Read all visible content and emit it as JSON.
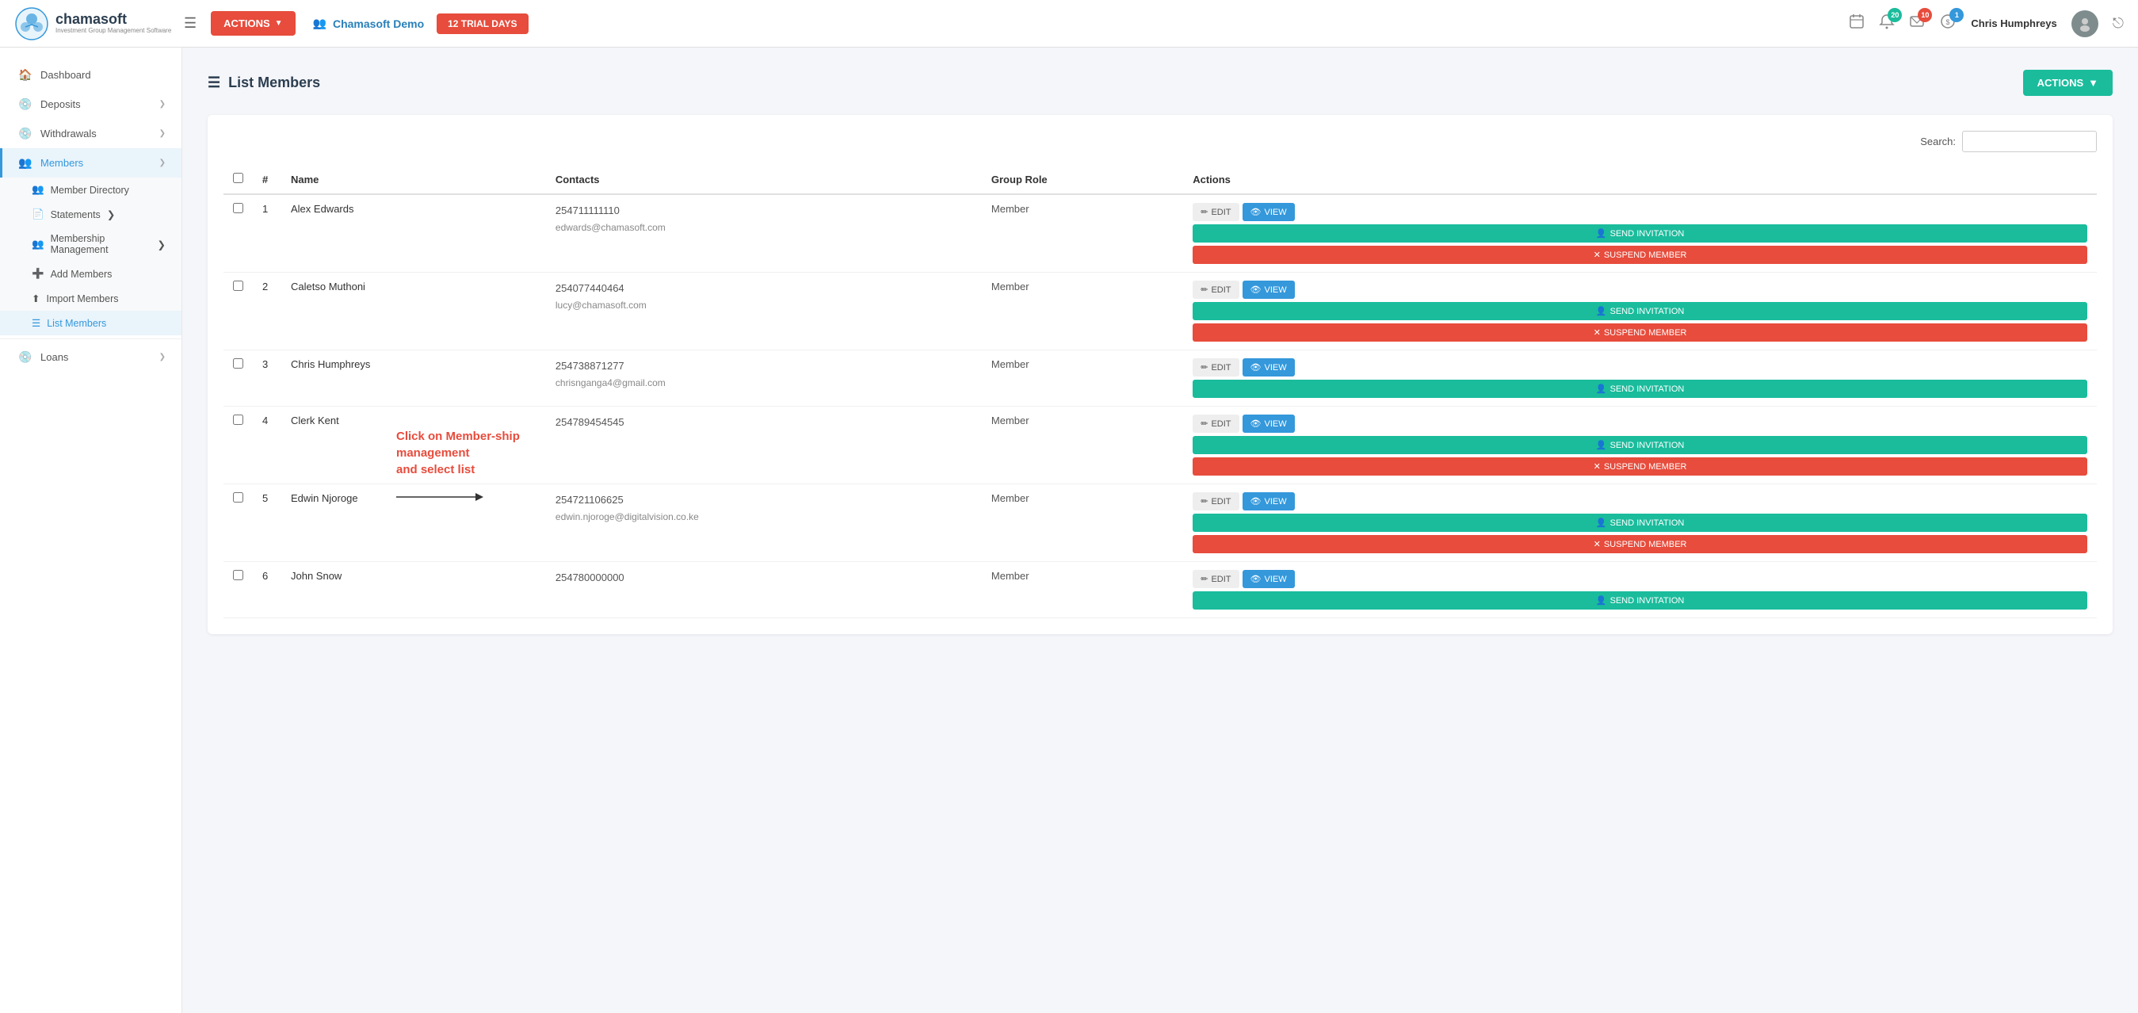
{
  "header": {
    "logo_name": "chamasoft",
    "logo_subtitle": "Investment Group Management Software",
    "hamburger_icon": "☰",
    "actions_label": "ACTIONS",
    "group_icon": "👥",
    "group_name": "Chamasoft Demo",
    "trial_label": "12 TRIAL DAYS",
    "notifications_count": "20",
    "messages_count": "10",
    "payments_count": "1",
    "user_name": "Chris Humphreys",
    "logout_icon": "⎋"
  },
  "sidebar": {
    "items": [
      {
        "id": "dashboard",
        "icon": "🏠",
        "label": "Dashboard",
        "active": false
      },
      {
        "id": "deposits",
        "icon": "💿",
        "label": "Deposits",
        "has_arrow": true,
        "active": false
      },
      {
        "id": "withdrawals",
        "icon": "💿",
        "label": "Withdrawals",
        "has_arrow": true,
        "active": false
      },
      {
        "id": "members",
        "icon": "👥",
        "label": "Members",
        "has_arrow": true,
        "active": true
      }
    ],
    "members_sub": [
      {
        "id": "member-directory",
        "icon": "👥",
        "label": "Member Directory",
        "active": false
      },
      {
        "id": "statements",
        "icon": "📄",
        "label": "Statements",
        "has_arrow": true,
        "active": false
      },
      {
        "id": "membership-management",
        "icon": "👥",
        "label": "Membership Management",
        "has_arrow": true,
        "active": false
      },
      {
        "id": "add-members",
        "icon": "➕",
        "label": "Add Members",
        "active": false
      },
      {
        "id": "import-members",
        "icon": "⬆",
        "label": "Import Members",
        "active": false
      },
      {
        "id": "list-members",
        "icon": "☰",
        "label": "List Members",
        "active": true
      }
    ],
    "loans": {
      "icon": "💿",
      "label": "Loans",
      "has_arrow": true
    }
  },
  "page": {
    "title": "List Members",
    "list_icon": "☰",
    "actions_label": "ACTIONS"
  },
  "search": {
    "label": "Search:",
    "placeholder": ""
  },
  "table": {
    "columns": [
      "#",
      "Name",
      "Contacts",
      "Group Role",
      "Actions"
    ],
    "rows": [
      {
        "num": "1",
        "name": "Alex Edwards",
        "phone": "254711111110",
        "email": "edwards@chamasoft.com",
        "role": "Member"
      },
      {
        "num": "2",
        "name": "Caletso Muthoni",
        "phone": "254077440464",
        "email": "lucy@chamasoft.com",
        "role": "Member"
      },
      {
        "num": "3",
        "name": "Chris Humphreys",
        "phone": "254738871277",
        "email": "chrisnganga4@gmail.com",
        "role": "Member"
      },
      {
        "num": "4",
        "name": "Clerk Kent",
        "phone": "254789454545",
        "email": "",
        "role": "Member"
      },
      {
        "num": "5",
        "name": "Edwin Njoroge",
        "phone": "254721106625",
        "email": "edwin.njoroge@digitalvision.co.ke",
        "role": "Member"
      },
      {
        "num": "6",
        "name": "John Snow",
        "phone": "254780000000",
        "email": "",
        "role": "Member"
      }
    ],
    "btn_edit": "EDIT",
    "btn_view": "VIEW",
    "btn_invite": "SEND INVITATION",
    "btn_suspend": "SUSPEND MEMBER"
  },
  "annotation": {
    "text": "Click on Member-ship management and select list",
    "arrow_text": "◄"
  },
  "colors": {
    "teal": "#1abc9c",
    "blue": "#3498db",
    "red": "#e74c3c",
    "edit_bg": "#eeeeee",
    "suspend_bg": "#e74c3c"
  }
}
